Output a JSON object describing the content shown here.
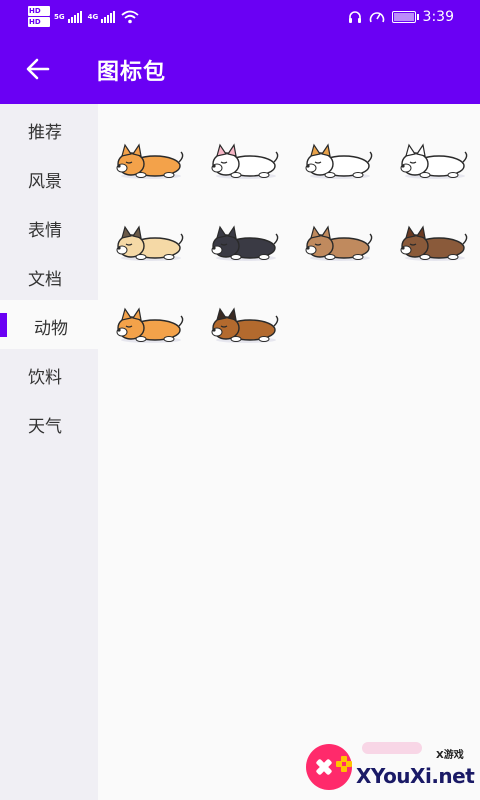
{
  "status_bar": {
    "hd_top": "HD",
    "hd_bottom": "HD",
    "net_1": "5G",
    "net_2": "4G",
    "time": "3:39",
    "icons": [
      "headset-icon",
      "speedometer-icon",
      "battery-icon"
    ]
  },
  "app_bar": {
    "title": "图标包",
    "back_icon": "arrow-left-icon"
  },
  "sidebar": {
    "items": [
      {
        "label": "推荐",
        "active": false
      },
      {
        "label": "风景",
        "active": false
      },
      {
        "label": "表情",
        "active": false
      },
      {
        "label": "文档",
        "active": false
      },
      {
        "label": "动物",
        "active": true
      },
      {
        "label": "饮料",
        "active": false
      },
      {
        "label": "天气",
        "active": false
      }
    ],
    "accent": "#6a00f4"
  },
  "stickers": [
    {
      "name": "corgi-sticker",
      "body": "#f3a24a",
      "ear": "#f3a24a"
    },
    {
      "name": "bull-terrier-sticker",
      "body": "#ffffff",
      "ear": "#f6b6c6"
    },
    {
      "name": "jack-russell-sticker",
      "body": "#ffffff",
      "ear": "#e8a24a"
    },
    {
      "name": "samoyed-sticker",
      "body": "#ffffff",
      "ear": "#ffffff"
    },
    {
      "name": "pug-sticker",
      "body": "#f5d9a6",
      "ear": "#6b5a48"
    },
    {
      "name": "boston-terrier-sticker",
      "body": "#3a3a44",
      "ear": "#3a3a44"
    },
    {
      "name": "chihuahua-sticker",
      "body": "#c08a5e",
      "ear": "#c08a5e"
    },
    {
      "name": "beagle-sticker",
      "body": "#8a5a3a",
      "ear": "#6a3a22"
    },
    {
      "name": "shiba-sticker",
      "body": "#f3a24a",
      "ear": "#f3a24a"
    },
    {
      "name": "german-shepherd-sticker",
      "body": "#b36a2e",
      "ear": "#3a2a22"
    }
  ],
  "watermark": {
    "small": "X游戏",
    "big": "XYouXi.net"
  },
  "colors": {
    "primary": "#6a00f4",
    "sidebar_bg": "#f0eff4",
    "content_bg": "#fafafa"
  }
}
